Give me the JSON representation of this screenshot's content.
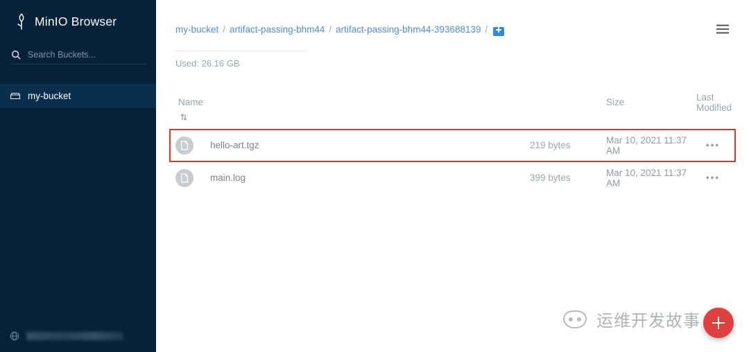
{
  "brand": {
    "title": "MinIO Browser"
  },
  "sidebar": {
    "search_placeholder": "Search Buckets...",
    "buckets": [
      {
        "name": "my-bucket"
      }
    ]
  },
  "breadcrumbs": {
    "items": [
      {
        "label": "my-bucket"
      },
      {
        "label": "artifact-passing-bhm44"
      },
      {
        "label": "artifact-passing-bhm44-393688139"
      }
    ],
    "sep": "/"
  },
  "storage": {
    "used_label": "Used: 26.16 GB"
  },
  "table": {
    "headers": {
      "name": "Name",
      "size": "Size",
      "modified": "Last Modified"
    },
    "rows": [
      {
        "icon": "file-icon",
        "name": "hello-art.tgz",
        "size": "219 bytes",
        "modified": "Mar 10, 2021 11:37 AM",
        "highlight": true
      },
      {
        "icon": "file-icon",
        "name": "main.log",
        "size": "399 bytes",
        "modified": "Mar 10, 2021 11:37 AM",
        "highlight": false
      }
    ]
  },
  "watermark": {
    "text": "运维开发故事"
  }
}
